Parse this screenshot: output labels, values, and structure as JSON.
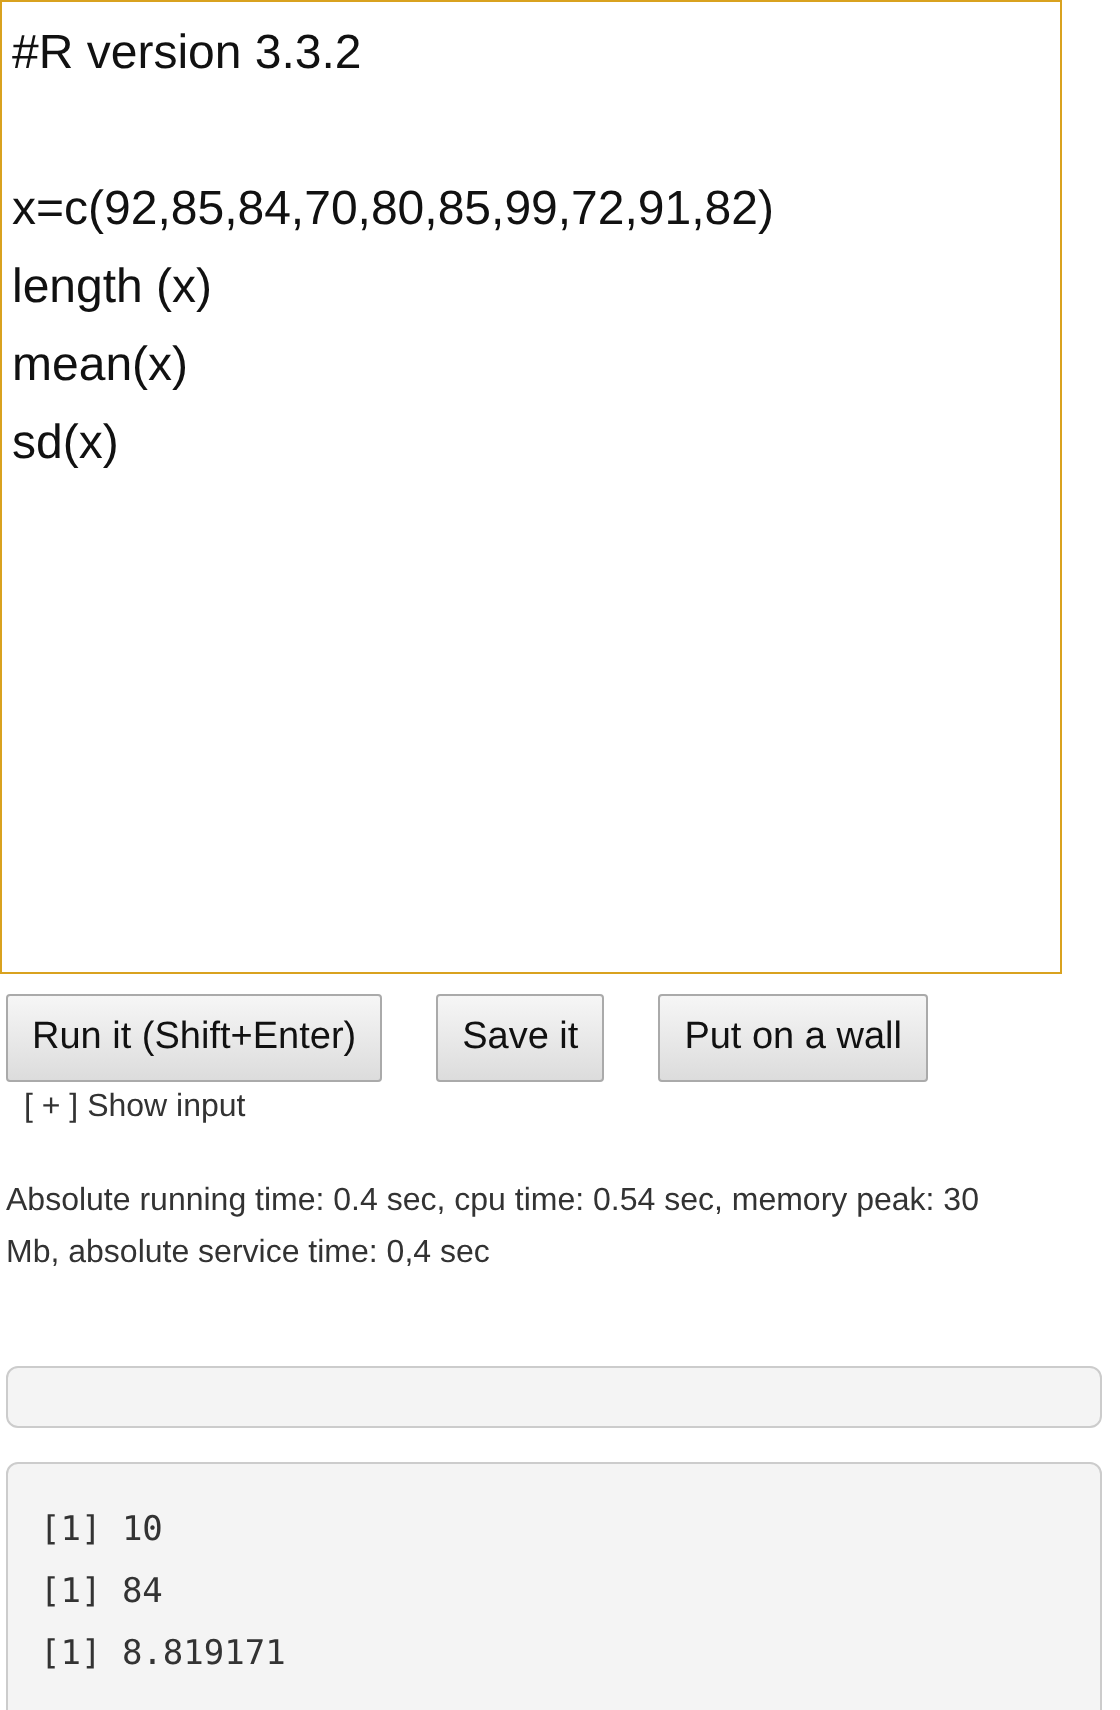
{
  "editor": {
    "value": "#R version 3.3.2\n\nx=c(92,85,84,70,80,85,99,72,91,82)\nlength (x)\nmean(x)\nsd(x)"
  },
  "buttons": [
    "Run it (Shift+Enter)",
    "Save it",
    "Put on a wall"
  ],
  "show_input_link": "[ + ] Show input",
  "run_stats": "Absolute running time: 0.4 sec, cpu time: 0.54 sec, memory peak: 30 Mb, absolute service time: 0,4 sec",
  "output_lines": [
    "[1] 10",
    "[1] 84",
    "[1] 8.819171"
  ]
}
